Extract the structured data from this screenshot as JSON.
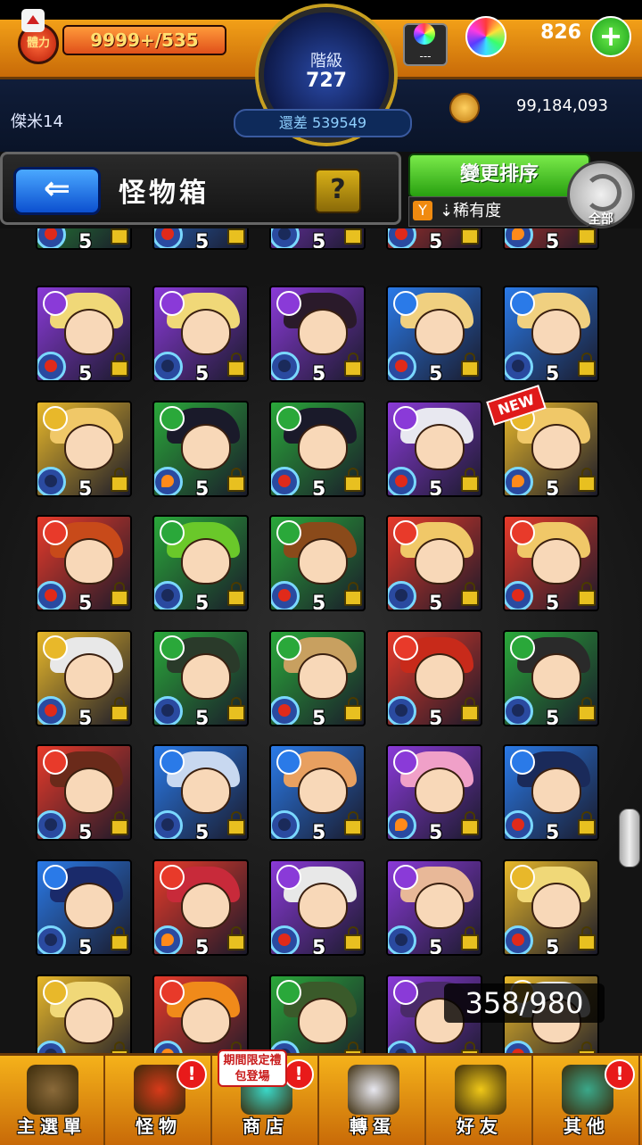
{
  "header": {
    "stamina_label": "體力",
    "stamina_value": "9999+",
    "stamina_max": "/535",
    "rank_label": "階級",
    "rank_value": "727",
    "exp_remaining": "還差 539549",
    "orb_box_text": "---",
    "orb_count": "826",
    "player_name": "傑米14",
    "gold": "99,184,093"
  },
  "toolbar": {
    "back_icon": "arrow-left-icon",
    "title": "怪物箱",
    "help_label": "?",
    "sort_button_label": "變更排序",
    "sort_mode": "稀有度",
    "all_label": "全部"
  },
  "colors": {
    "fire": "#e83a2a",
    "water": "#2a7ae8",
    "wood": "#2aa83a",
    "light": "#e8b82a",
    "dark": "#8a3ad8"
  },
  "monster_grid": {
    "new_badge": "NEW",
    "rows": [
      {
        "cells": [
          {
            "element": "wood",
            "fruit": "red",
            "level": "5",
            "hair": "#e8a0c8"
          },
          {
            "element": "water",
            "fruit": "red",
            "level": "5",
            "hair": "#2a2a3a"
          },
          {
            "element": "dark",
            "fruit": "blue",
            "level": "5",
            "hair": "#3a2a2a"
          },
          {
            "element": "fire",
            "fruit": "red",
            "level": "5",
            "hair": "#3a2a2a"
          },
          {
            "element": "fire",
            "fruit": "fire",
            "level": "5",
            "hair": "#e84a4a"
          }
        ]
      },
      {
        "cells": [
          {
            "element": "dark",
            "fruit": "red",
            "level": "5",
            "hair": "#f0d878"
          },
          {
            "element": "dark",
            "fruit": "blue",
            "level": "5",
            "hair": "#f0d878"
          },
          {
            "element": "dark",
            "fruit": "blue",
            "level": "5",
            "hair": "#2a1a2a"
          },
          {
            "element": "water",
            "fruit": "red",
            "level": "5",
            "hair": "#f0d080"
          },
          {
            "element": "water",
            "fruit": "blue",
            "level": "5",
            "hair": "#f0d080"
          }
        ]
      },
      {
        "cells": [
          {
            "element": "light",
            "fruit": "blue",
            "level": "5",
            "hair": "#f0c868"
          },
          {
            "element": "wood",
            "fruit": "fire",
            "level": "5",
            "hair": "#1a1a2a"
          },
          {
            "element": "wood",
            "fruit": "red",
            "level": "5",
            "hair": "#1a1a2a"
          },
          {
            "element": "dark",
            "fruit": "red",
            "level": "5",
            "hair": "#e8e8f0"
          },
          {
            "element": "light",
            "fruit": "fire",
            "level": "5",
            "hair": "#f0c868"
          }
        ]
      },
      {
        "cells": [
          {
            "element": "fire",
            "fruit": "red",
            "level": "5",
            "hair": "#c84a1a"
          },
          {
            "element": "wood",
            "fruit": "blue",
            "level": "5",
            "hair": "#6ac82a"
          },
          {
            "element": "wood",
            "fruit": "red",
            "level": "5",
            "hair": "#8a4a1a"
          },
          {
            "element": "fire",
            "fruit": "blue",
            "level": "5",
            "hair": "#f0c868"
          },
          {
            "element": "fire",
            "fruit": "red",
            "level": "5",
            "hair": "#f0c868"
          }
        ]
      },
      {
        "cells": [
          {
            "element": "light",
            "fruit": "red",
            "level": "5",
            "hair": "#e8e8e8"
          },
          {
            "element": "wood",
            "fruit": "blue",
            "level": "5",
            "hair": "#2a3a2a"
          },
          {
            "element": "wood",
            "fruit": "red",
            "level": "5",
            "hair": "#c8a060"
          },
          {
            "element": "fire",
            "fruit": "blue",
            "level": "5",
            "hair": "#c82a1a"
          },
          {
            "element": "wood",
            "fruit": "blue",
            "level": "5",
            "hair": "#2a2a2a"
          }
        ]
      },
      {
        "cells": [
          {
            "element": "fire",
            "fruit": "blue",
            "level": "5",
            "hair": "#6a2a1a"
          },
          {
            "element": "water",
            "fruit": "blue",
            "level": "5",
            "hair": "#c8d8f0"
          },
          {
            "element": "water",
            "fruit": "blue",
            "level": "5",
            "hair": "#e8a060"
          },
          {
            "element": "dark",
            "fruit": "fire",
            "level": "5",
            "hair": "#f0a0c8"
          },
          {
            "element": "water",
            "fruit": "red",
            "level": "5",
            "hair": "#1a2a5a"
          }
        ]
      },
      {
        "cells": [
          {
            "element": "water",
            "fruit": "blue",
            "level": "5",
            "hair": "#1a2a6a"
          },
          {
            "element": "fire",
            "fruit": "fire",
            "level": "5",
            "hair": "#c82a3a"
          },
          {
            "element": "dark",
            "fruit": "red",
            "level": "5",
            "hair": "#e8e8e8"
          },
          {
            "element": "dark",
            "fruit": "blue",
            "level": "5",
            "hair": "#e8b898"
          },
          {
            "element": "light",
            "fruit": "red",
            "level": "5",
            "hair": "#f0d878"
          }
        ]
      },
      {
        "cells": [
          {
            "element": "light",
            "fruit": "blue",
            "level": "5",
            "hair": "#f0d878"
          },
          {
            "element": "fire",
            "fruit": "fire",
            "level": "5",
            "hair": "#f08a1a"
          },
          {
            "element": "wood",
            "fruit": "blue",
            "level": "5",
            "hair": "#3a5a2a"
          },
          {
            "element": "dark",
            "fruit": "blue",
            "level": "5",
            "hair": "#4a2a6a"
          },
          {
            "element": "light",
            "fruit": "red",
            "level": "5",
            "hair": "#e8e8e8"
          }
        ]
      }
    ]
  },
  "box_count": "358/980",
  "bottom_nav": {
    "promo_text": "期間限定禮包登場",
    "alert": "!",
    "items": [
      {
        "label": "主選單",
        "icon": "castle-icon",
        "color": "#8a6a3a",
        "alert": false
      },
      {
        "label": "怪物",
        "icon": "monster-icon",
        "color": "#d83a1a",
        "alert": true
      },
      {
        "label": "商店",
        "icon": "orb-icon",
        "color": "#3ad8c8",
        "alert": true
      },
      {
        "label": "轉蛋",
        "icon": "gacha-icon",
        "color": "#e8e8f0",
        "alert": false
      },
      {
        "label": "好友",
        "icon": "friends-icon",
        "color": "#f0c818",
        "alert": false
      },
      {
        "label": "其他",
        "icon": "other-icon",
        "color": "#3aa88a",
        "alert": true
      }
    ]
  }
}
